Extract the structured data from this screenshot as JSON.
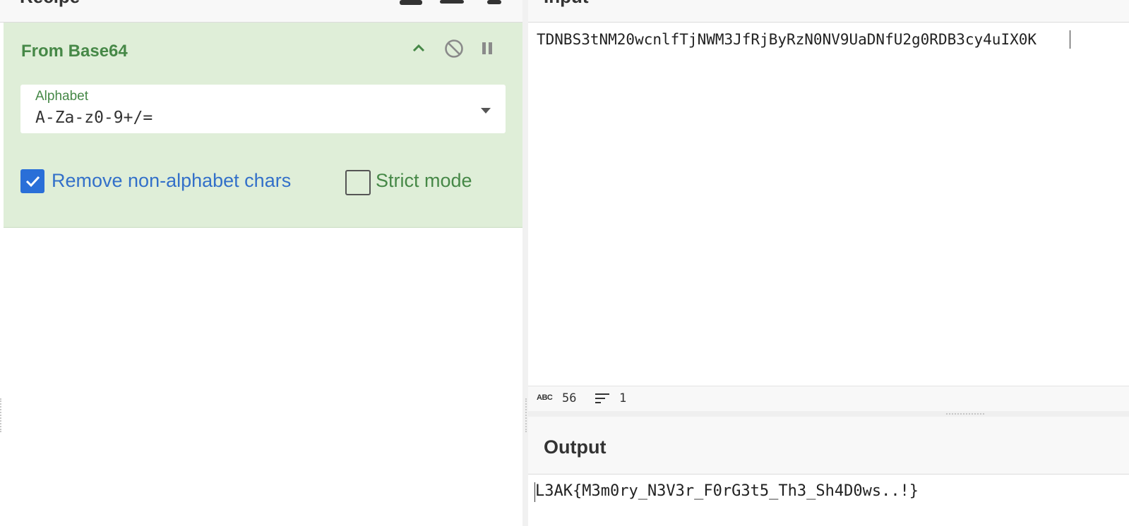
{
  "recipe": {
    "title": "Recipe",
    "operation": {
      "name": "From Base64",
      "alphabet_label": "Alphabet",
      "alphabet_value": "A-Za-z0-9+/=",
      "remove_non_alphabet": {
        "label": "Remove non-alphabet chars",
        "checked": true
      },
      "strict_mode": {
        "label": "Strict mode",
        "checked": false
      }
    }
  },
  "input": {
    "title": "Input",
    "text": "TDNBS3tNM20wcnlfTjNWM3JfRjByRzN0NV9UaDNfU2g0RDB3cy4uIX0K",
    "status": {
      "abc_label": "ABC",
      "char_count": "56",
      "line_count": "1"
    }
  },
  "output": {
    "title": "Output",
    "text": "L3AK{M3m0ry_N3V3r_F0rG3t5_Th3_Sh4D0ws..!}"
  },
  "colors": {
    "accent_green": "#468847",
    "card_bg": "#dfeed8",
    "check_blue": "#2a6fd8"
  }
}
